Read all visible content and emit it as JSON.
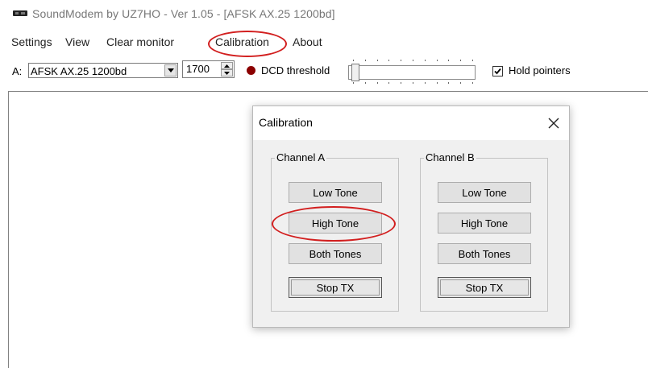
{
  "window": {
    "title": "SoundModem by UZ7HO - Ver 1.05 - [AFSK AX.25 1200bd]",
    "icon": "soundcard-icon"
  },
  "menu": {
    "items": [
      "Settings",
      "View",
      "Clear monitor",
      "Calibration",
      "About"
    ]
  },
  "toolbar": {
    "channel_label": "A:",
    "modem_value": "AFSK AX.25 1200bd",
    "freq_value": "1700",
    "dcd_label": "DCD threshold",
    "dcd_color": "#8b0000",
    "hold_checked": true,
    "hold_label": "Hold pointers"
  },
  "dialog": {
    "title": "Calibration",
    "channel_a": {
      "label": "Channel A",
      "low": "Low Tone",
      "high": "High Tone",
      "both": "Both Tones",
      "stop": "Stop TX"
    },
    "channel_b": {
      "label": "Channel B",
      "low": "Low Tone",
      "high": "High Tone",
      "both": "Both Tones",
      "stop": "Stop TX"
    }
  },
  "annotation_color": "#d21f1f"
}
